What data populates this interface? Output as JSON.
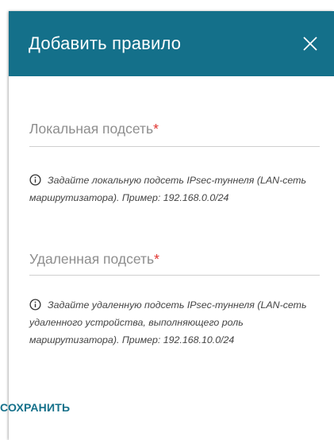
{
  "dialog": {
    "title": "Добавить правило",
    "close_icon": "close-icon",
    "header_color": "#14708a",
    "accent_color": "#14708a",
    "required_color": "#e0332f"
  },
  "fields": {
    "local_subnet": {
      "label": "Локальная подсеть",
      "required_mark": "*",
      "value": "",
      "hint": "Задайте локальную подсеть IPsec-туннеля (LAN-сеть маршрутизатора). Пример: 192.168.0.0/24",
      "hint_icon": "info-icon"
    },
    "remote_subnet": {
      "label": "Удаленная подсеть",
      "required_mark": "*",
      "value": "",
      "hint": "Задайте удаленную подсеть IPsec-туннеля (LAN-сеть удаленного устройства, выполняющего роль маршрутизатора). Пример: 192.168.10.0/24",
      "hint_icon": "info-icon"
    }
  },
  "actions": {
    "save_label": "СОХРАНИТЬ"
  }
}
